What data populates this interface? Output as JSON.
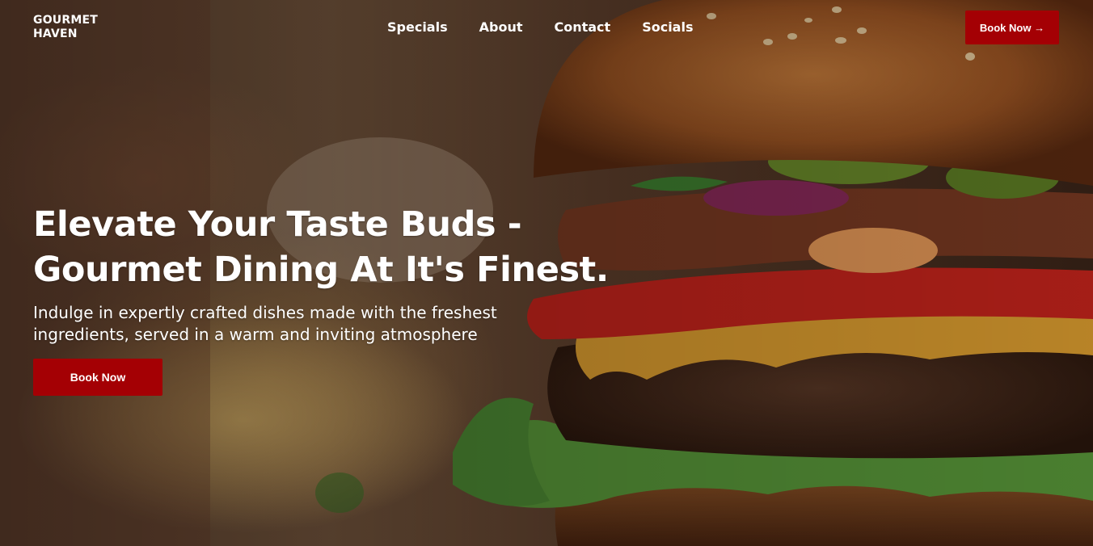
{
  "header": {
    "logo_line1": "GOURMET",
    "logo_line2": "HAVEN",
    "nav": [
      "Specials",
      "About",
      "Contact",
      "Socials"
    ],
    "cta_label": "Book Now →"
  },
  "hero": {
    "headline_line1": "Elevate Your Taste Buds -",
    "headline_line2": "Gourmet Dining At It's Finest.",
    "subtext": "Indulge in expertly crafted dishes made with the freshest ingredients, served in a warm and inviting atmosphere",
    "cta_label": "Book Now"
  },
  "colors": {
    "accent": "#a40004",
    "text": "#ffffff"
  },
  "background_image": "burger-and-fries-photo"
}
